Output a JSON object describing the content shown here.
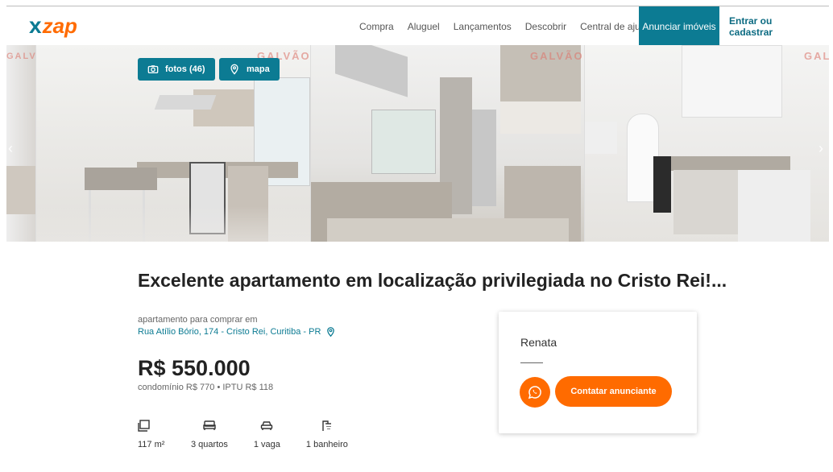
{
  "header": {
    "logo_mark": "x",
    "logo_text": "zap",
    "nav": [
      "Compra",
      "Aluguel",
      "Lançamentos",
      "Descobrir",
      "Central de ajuda"
    ],
    "anunciar_label": "Anunciar imóveis",
    "entrar_label": "Entrar ou cadastrar"
  },
  "gallery": {
    "photos_label": "fotos (46)",
    "map_label": "mapa",
    "prev_icon": "chevron-left-icon",
    "next_icon": "chevron-right-icon",
    "watermark": "GALVÃO"
  },
  "listing": {
    "title": "Excelente apartamento em localização privilegiada no Cristo Rei!...",
    "subtype": "apartamento para comprar em",
    "address": "Rua Atílio Bório, 174 - Cristo Rei, Curitiba - PR",
    "price": "R$ 550.000",
    "fees": "condomínio R$ 770  •  IPTU R$ 118",
    "features": [
      {
        "icon": "area-icon",
        "label": "117 m²"
      },
      {
        "icon": "bed-icon",
        "label": "3 quartos"
      },
      {
        "icon": "car-icon",
        "label": "1 vaga"
      },
      {
        "icon": "shower-icon",
        "label": "1 banheiro"
      }
    ]
  },
  "advertiser": {
    "name": "Renata",
    "contact_label": "Contatar anunciante"
  },
  "colors": {
    "brand_teal": "#0c7b93",
    "brand_orange": "#ff6b00"
  }
}
